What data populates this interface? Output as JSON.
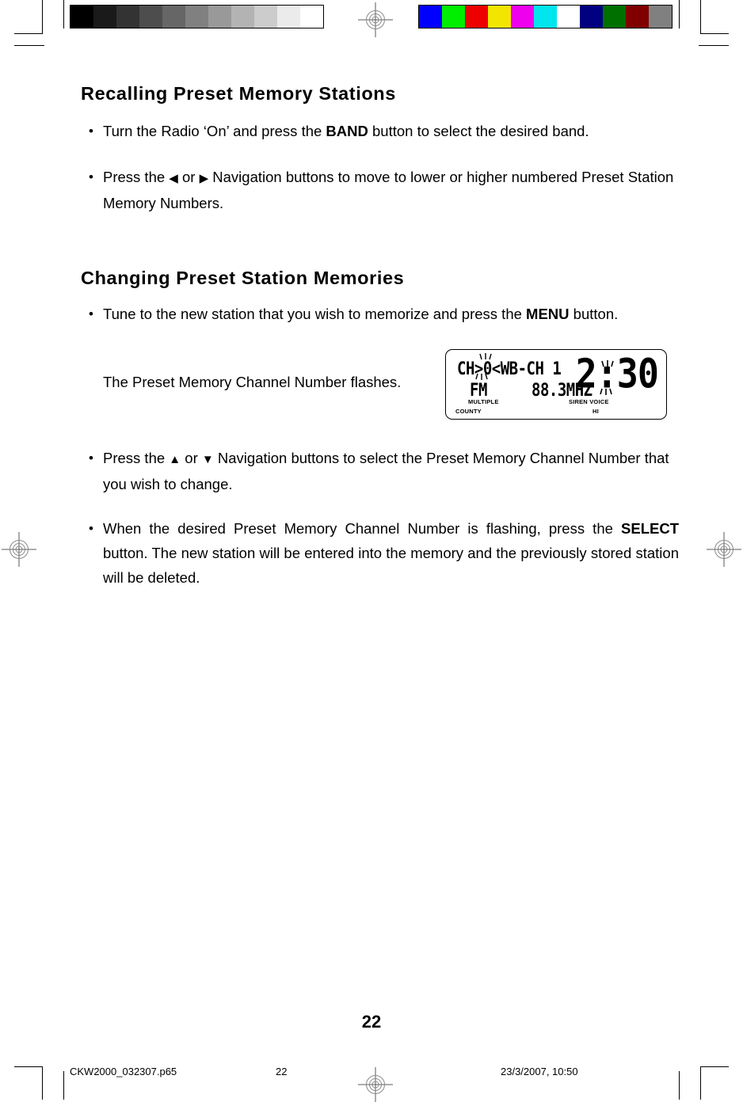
{
  "document": {
    "page_number": "22"
  },
  "sections": [
    {
      "heading": "Recalling Preset Memory Stations"
    },
    {
      "heading": "Changing Preset Station Memories"
    }
  ],
  "bullets": {
    "marker": "•",
    "b1": {
      "pre": "Turn the Radio ‘On’ and press the ",
      "bold": "BAND",
      "post": " button to select the desired band."
    },
    "b2": {
      "pre": "Press the ",
      "left_arrow": "◀",
      "mid": " or ",
      "right_arrow": "▶",
      "post": " Navigation buttons to move to lower or higher numbered Preset Station Memory Numbers."
    },
    "b3": {
      "pre": "Tune to the new station that you wish to memorize and press the ",
      "bold": "MENU",
      "post": " button."
    },
    "b4": {
      "pre": "Press the ",
      "up_arrow": "▲",
      "mid": " or ",
      "down_arrow": "▼",
      "post": " Navigation buttons to select the Preset Memory Channel Number that you wish to change."
    },
    "b5": {
      "pre": "When the desired Preset Memory Channel Number is flashing, press the ",
      "bold": "SELECT",
      "mid": " button. The new station will be entered into the memory and the ",
      "post": "previously stored station will be deleted."
    }
  },
  "flash_note": "The Preset Memory Channel Number flashes.",
  "lcd_display": {
    "line1": "CH>0<WB-CH 1",
    "line1_prefix": "CH>",
    "line1_channel": "0",
    "line1_suffix": "<WB-CH 1",
    "band": "FM",
    "frequency": "88.3MHZ",
    "clock": "2:30",
    "labels": {
      "multiple": "MULTIPLE",
      "county": "COUNTY",
      "siren_voice": "SIREN VOICE",
      "hi": "HI"
    }
  },
  "footer": {
    "filename": "CKW2000_032307.p65",
    "page": "22",
    "timestamp": "23/3/2007, 10:50"
  },
  "calibration": {
    "grayscale": [
      "#000000",
      "#1a1a1a",
      "#333333",
      "#4d4d4d",
      "#666666",
      "#808080",
      "#999999",
      "#b3b3b3",
      "#cccccc",
      "#ebebeb",
      "#ffffff"
    ],
    "colors": [
      "#0000ff",
      "#00ee00",
      "#ee0000",
      "#f2e600",
      "#ee00ee",
      "#00e5ee",
      "#ffffff",
      "#000080",
      "#007000",
      "#800000",
      "#808080"
    ]
  }
}
